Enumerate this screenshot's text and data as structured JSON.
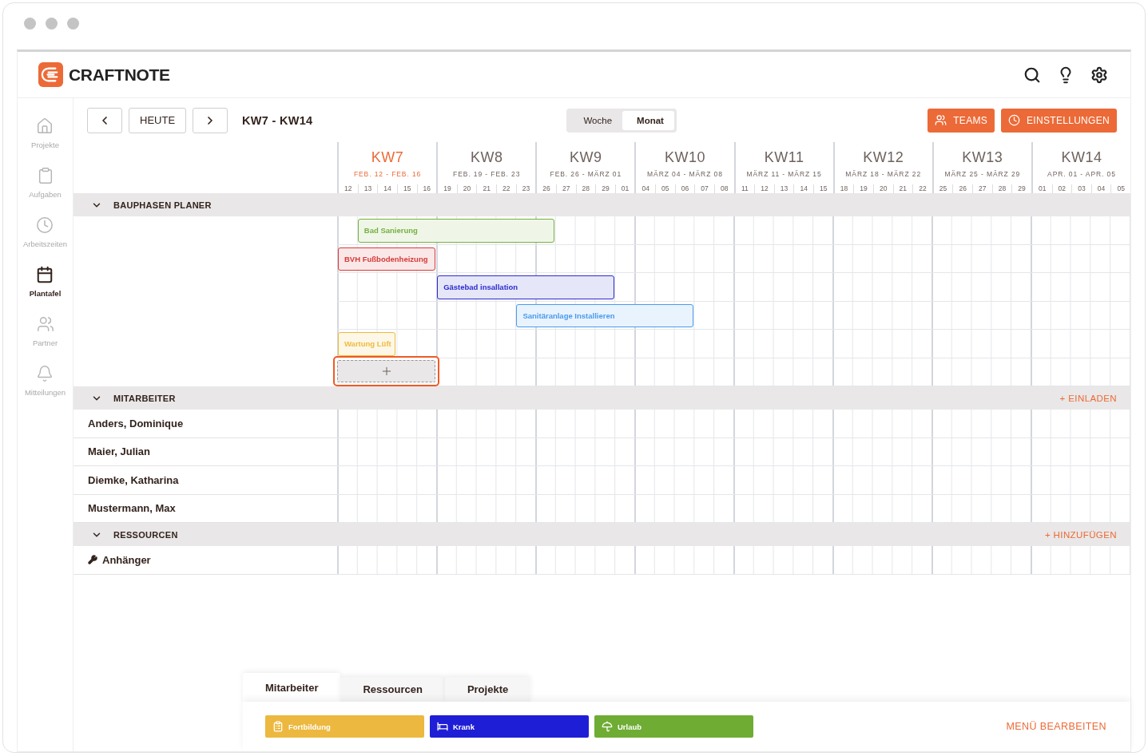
{
  "app": {
    "brand": "CRAFTNOTE"
  },
  "sidebar": {
    "items": [
      {
        "label": "Projekte",
        "kind": "home",
        "selected": false
      },
      {
        "label": "Aufgaben",
        "kind": "clipboard",
        "selected": false
      },
      {
        "label": "Arbeitszeiten",
        "kind": "clock",
        "selected": false
      },
      {
        "label": "Plantafel",
        "kind": "calendar",
        "selected": true
      },
      {
        "label": "Partner",
        "kind": "users",
        "selected": false
      },
      {
        "label": "Mitteilungen",
        "kind": "bell",
        "selected": false
      }
    ]
  },
  "toolbar": {
    "today": "HEUTE",
    "range": "KW7 - KW14",
    "views": [
      {
        "label": "Woche",
        "selected": false
      },
      {
        "label": "Monat",
        "selected": true
      }
    ],
    "actions": [
      {
        "label": "TEAMS",
        "kind": "teams"
      },
      {
        "label": "EINSTELLUNGEN",
        "kind": "clock"
      }
    ]
  },
  "timeline": {
    "weeks": [
      {
        "label": "KW7",
        "range": "FEB. 12 - FEB. 16",
        "selected": true,
        "days": [
          "12",
          "13",
          "14",
          "15",
          "16"
        ]
      },
      {
        "label": "KW8",
        "range": "FEB. 19 - FEB. 23",
        "selected": false,
        "days": [
          "19",
          "20",
          "21",
          "22",
          "23"
        ]
      },
      {
        "label": "KW9",
        "range": "FEB. 26 - MÄRZ 01",
        "selected": false,
        "days": [
          "26",
          "27",
          "28",
          "29",
          "01"
        ]
      },
      {
        "label": "KW10",
        "range": "MÄRZ 04 - MÄRZ 08",
        "selected": false,
        "days": [
          "04",
          "05",
          "06",
          "07",
          "08"
        ]
      },
      {
        "label": "KW11",
        "range": "MÄRZ 11 - MÄRZ 15",
        "selected": false,
        "days": [
          "11",
          "12",
          "13",
          "14",
          "15"
        ]
      },
      {
        "label": "KW12",
        "range": "MÄRZ 18 - MÄRZ 22",
        "selected": false,
        "days": [
          "18",
          "19",
          "20",
          "21",
          "22"
        ]
      },
      {
        "label": "KW13",
        "range": "MÄRZ 25 - MÄRZ 29",
        "selected": false,
        "days": [
          "25",
          "26",
          "27",
          "28",
          "29"
        ]
      },
      {
        "label": "KW14",
        "range": "APR. 01 - APR. 05",
        "selected": false,
        "days": [
          "01",
          "02",
          "03",
          "04",
          "05"
        ]
      }
    ]
  },
  "sections": [
    {
      "title": "BAUPHASEN PLANER",
      "kind": "phases",
      "expanded": true,
      "rows": [
        {
          "label": "Bad Sanierung",
          "color": "#76b041"
        },
        {
          "label": "BVH Fußbodenheizung",
          "color": "#d63a3a"
        },
        {
          "label": "Gästebad insallation",
          "color": "#2b2bd1"
        },
        {
          "label": "Sanitäranlage Installieren",
          "color": "#4a9bef"
        },
        {
          "label": "Wartung Lüft",
          "color": "#f0bb3c"
        }
      ]
    },
    {
      "title": "MITARBEITER",
      "kind": "people",
      "expanded": true,
      "action": "+ EINLADEN",
      "rows": [
        {
          "name": "Anders, Dominique"
        },
        {
          "name": "Maier, Julian"
        },
        {
          "name": "Diemke, Katharina"
        },
        {
          "name": "Mustermann, Max"
        }
      ]
    },
    {
      "title": "RESSOURCEN",
      "kind": "resources",
      "expanded": true,
      "action": "+ HINZUFÜGEN",
      "rows": [
        {
          "name": "Anhänger"
        }
      ]
    }
  ],
  "palette": {
    "tabs": [
      {
        "label": "Mitarbeiter",
        "selected": true
      },
      {
        "label": "Ressourcen",
        "selected": false
      },
      {
        "label": "Projekte",
        "selected": false
      }
    ],
    "categories": [
      {
        "label": "Fortbildung",
        "kind": "training",
        "color": "#ecb83f"
      },
      {
        "label": "Krank",
        "kind": "sick",
        "color": "#1e1ed6"
      },
      {
        "label": "Urlaub",
        "kind": "vacation",
        "color": "#6fac34"
      }
    ],
    "edit_link": "MENÜ BEARBEITEN"
  }
}
